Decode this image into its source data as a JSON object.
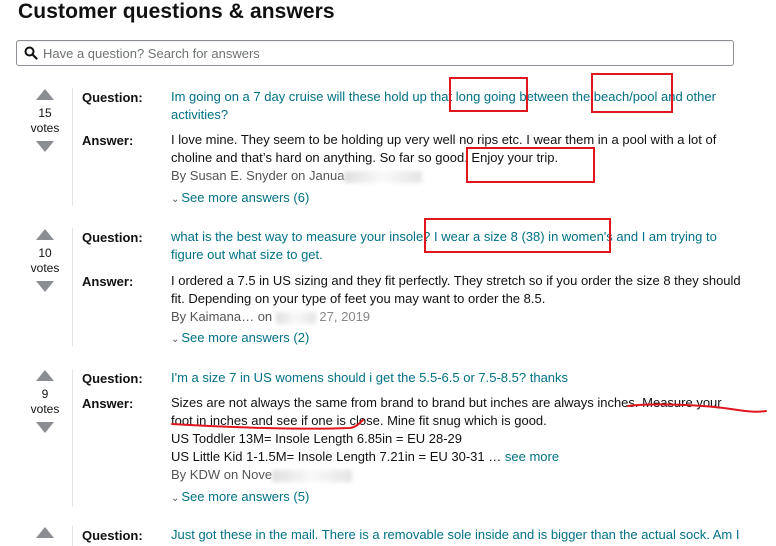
{
  "page": {
    "title": "Customer questions & answers"
  },
  "search": {
    "placeholder": "Have a question? Search for answers"
  },
  "labels": {
    "question": "Question:",
    "answer": "Answer:",
    "votes": "votes"
  },
  "questions": [
    {
      "votes": "15",
      "question": "Im going on a 7 day cruise will these hold up that long going between the beach/pool and other activities?",
      "answer": "I love mine. They seem to be holding up very well no rips etc. I wear them in a pool with a lot of choline and that’s hard on anything. So far so good. Enjoy your trip.",
      "byline": "By Susan E. Snyder on Janua",
      "see_more": "See more answers (6)"
    },
    {
      "votes": "10",
      "question": "what is the best way to measure your insole? I wear a size 8 (38) in women's and I am trying to figure out what size to get.",
      "answer": "I ordered a 7.5 in US sizing and they fit perfectly. They stretch so if you order the size 8 they should fit. Depending on your type of feet you may want to order the 8.5.",
      "byline": "By Kaimana… on",
      "byline_tail": "27, 2019",
      "see_more": "See more answers (2)"
    },
    {
      "votes": "9",
      "question": "I'm a size 7 in US womens should i get the 5.5-6.5 or 7.5-8.5? thanks",
      "answer": "Sizes are not always the same from brand to brand but inches are always inches. Measure your foot in inches and see if one is close. Mine fit snug which is good.",
      "answer_line2": "US Toddler 13M= Insole Length 6.85in = EU 28-29",
      "answer_line3": "US Little Kid 1-1.5M= Insole Length 7.21in = EU 30-31 …",
      "answer_see_more": "see more",
      "byline": "By KDW on Nove",
      "see_more": "See more answers (5)"
    },
    {
      "question": "Just got these in the mail. There is a removable sole inside and is bigger than the actual sock. Am I"
    }
  ],
  "colors": {
    "link": "#007185",
    "annotation_red": "#e0171e",
    "vote_arrow": "#8a8d91"
  }
}
